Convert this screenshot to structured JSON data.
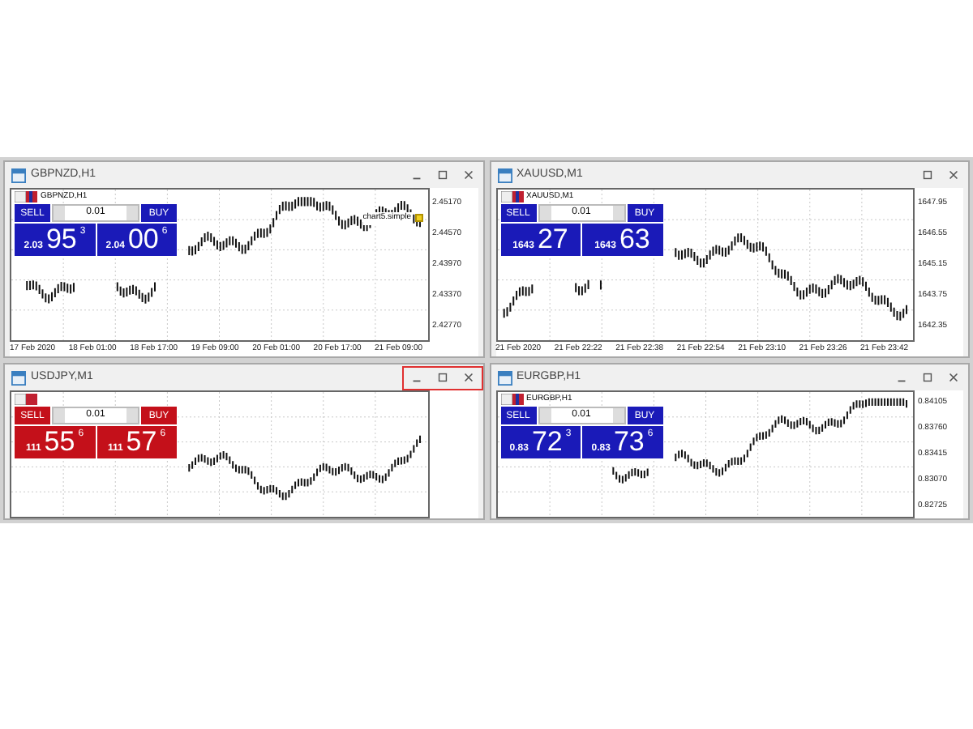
{
  "windows": [
    {
      "title": "GBPNZD,H1",
      "symbol_label": "GBPNZD,H1",
      "color": "#1a1ab8",
      "minimize_button": true,
      "maximize_button": true,
      "close_button": true,
      "buttons_highlighted": false,
      "annotation": "chart5.simple",
      "sell_label": "SELL",
      "lot": "0.01",
      "buy_label": "BUY",
      "sell_price": {
        "prefix": "2.03",
        "pips": "95",
        "fraction": "3"
      },
      "buy_price": {
        "prefix": "2.04",
        "pips": "00",
        "fraction": "6"
      },
      "price_axis": [
        "2.45170",
        "2.44570",
        "2.43970",
        "2.43370",
        "2.42770"
      ],
      "time_axis": [
        "17 Feb 2020",
        "18 Feb 01:00",
        "18 Feb 17:00",
        "19 Feb 09:00",
        "20 Feb 01:00",
        "20 Feb 17:00",
        "21 Feb 09:00"
      ]
    },
    {
      "title": "XAUUSD,M1",
      "symbol_label": "XAUUSD,M1",
      "color": "#1a1ab8",
      "minimize_button": false,
      "maximize_button": true,
      "close_button": true,
      "buttons_highlighted": false,
      "sell_label": "SELL",
      "lot": "0.01",
      "buy_label": "BUY",
      "sell_price": {
        "prefix": "1643",
        "pips": "27"
      },
      "buy_price": {
        "prefix": "1643",
        "pips": "63"
      },
      "price_axis": [
        "1647.95",
        "1646.55",
        "1645.15",
        "1643.75",
        "1642.35"
      ],
      "time_axis": [
        "21 Feb 2020",
        "21 Feb 22:22",
        "21 Feb 22:38",
        "21 Feb 22:54",
        "21 Feb 23:10",
        "21 Feb 23:26",
        "21 Feb 23:42"
      ]
    },
    {
      "title": "USDJPY,M1",
      "color": "#c4101a",
      "minimize_button": true,
      "maximize_button": true,
      "close_button": true,
      "buttons_highlighted": true,
      "sell_label": "SELL",
      "lot": "0.01",
      "buy_label": "BUY",
      "sell_price": {
        "prefix": "111",
        "pips": "55",
        "fraction": "6"
      },
      "buy_price": {
        "prefix": "111",
        "pips": "57",
        "fraction": "6"
      }
    },
    {
      "title": "EURGBP,H1",
      "symbol_label": "EURGBP,H1",
      "color": "#1a1ab8",
      "minimize_button": true,
      "maximize_button": true,
      "close_button": true,
      "buttons_highlighted": false,
      "sell_label": "SELL",
      "lot": "0.01",
      "buy_label": "BUY",
      "sell_price": {
        "prefix": "0.83",
        "pips": "72",
        "fraction": "3"
      },
      "buy_price": {
        "prefix": "0.83",
        "pips": "73",
        "fraction": "6"
      },
      "price_axis": [
        "0.84105",
        "0.83760",
        "0.83415",
        "0.83070",
        "0.82725"
      ]
    }
  ]
}
